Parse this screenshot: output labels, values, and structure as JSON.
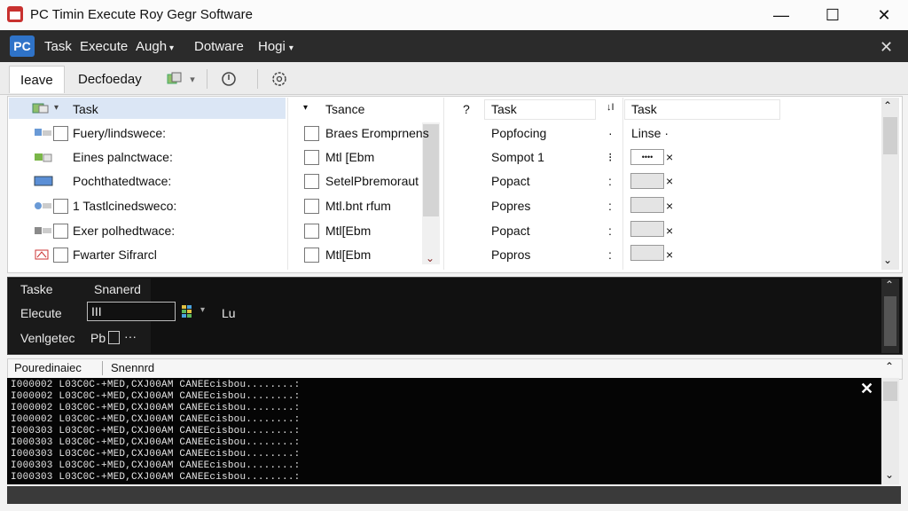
{
  "window": {
    "title": "PC Timin Execute Roy Gegr Software",
    "minimize": "—",
    "maximize": "☐",
    "close": "✕"
  },
  "menubar": {
    "logo": "PC",
    "items": [
      "Task",
      "Execute",
      "Augh",
      "Dotware",
      "Hogi"
    ],
    "close": "✕"
  },
  "tabs": {
    "active": "Ieave",
    "second": "Decfoeday"
  },
  "toolbar": {
    "icons": [
      "copy-icon",
      "chevron-down-icon",
      "power-icon",
      "settings-icon"
    ]
  },
  "grid": {
    "headers": {
      "task": "Task",
      "tsance": "Tsance",
      "help": "?",
      "task2": "Task",
      "sort": "↓I",
      "task3": "Task"
    },
    "rows": [
      {
        "name": "Fuery/lindswece:",
        "desc": "Braes Eromprnens",
        "task": "Popfocing",
        "sep": "·",
        "extra": "Linse ·"
      },
      {
        "name": "Eines palnctwace:",
        "desc": "Mtl [Ebm",
        "task": "Sompot 1",
        "sep": "⁝",
        "extra": "••••"
      },
      {
        "name": "Pochthatedtwace:",
        "desc": "SetelPbremoraut",
        "task": "Popact",
        "sep": ":",
        "extra": ""
      },
      {
        "name": "1 Tastlcinedsweco:",
        "desc": "Mtl.bnt rfum",
        "task": "Popres",
        "sep": ":",
        "extra": ""
      },
      {
        "name": "Exer polhedtwace:",
        "desc": "Mtl[Ebm",
        "task": "Popact",
        "sep": ":",
        "extra": ""
      },
      {
        "name": "Fwarter    Sifrarcl",
        "desc": "Mtl[Ebm",
        "task": "Popros",
        "sep": ":",
        "extra": ""
      }
    ]
  },
  "midpanel": {
    "task_label": "Taske",
    "task_value": "Snanerd",
    "execute_label": "Elecute",
    "execute_value": "III",
    "lu_label": "Lu",
    "verify_label": "Venlgetec",
    "verify_value": "Pb",
    "verify_more": "···"
  },
  "output": {
    "tab1": "Pouredinaiec",
    "tab2": "Snennrd",
    "lines": [
      "I000002 L03C0C-+MED,CXJ00AM  CANEEcisbou........:",
      "I000002 L03C0C-+MED,CXJ00AM  CANEEcisbou........:",
      "I000002 L03C0C-+MED,CXJ00AM  CANEEcisbou........:",
      "I000002 L03C0C-+MED,CXJ00AM  CANEEcisbou........:",
      "I000303 L03C0C-+MED,CXJ00AM  CANEEcisbou........:",
      "I000303 L03C0C-+MED,CXJ00AM  CANEEcisbou........:",
      "I000303 L03C0C-+MED,CXJ00AM  CANEEcisbou........:",
      "I000303 L03C0C-+MED,CXJ00AM  CANEEcisbou........:",
      "I000303 L03C0C-+MED,CXJ00AM  CANEEcisbou........:"
    ],
    "close": "✕"
  },
  "colors": {
    "menubar": "#2b2b2b",
    "logo": "#2f73c8",
    "header_highlight": "#dbe6f5",
    "console_bg": "#050505"
  }
}
